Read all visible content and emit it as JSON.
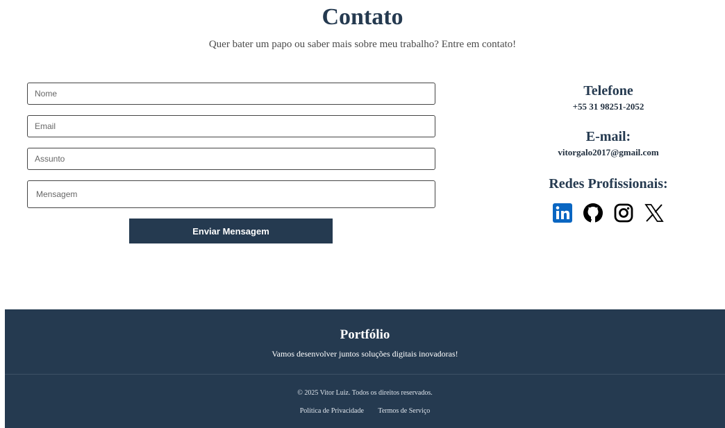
{
  "header": {
    "title": "Contato",
    "subtitle": "Quer bater um papo ou saber mais sobre meu trabalho? Entre em contato!"
  },
  "form": {
    "name_placeholder": "Nome",
    "email_placeholder": "Email",
    "subject_placeholder": "Assunto",
    "message_placeholder": "Mensagem",
    "submit_label": "Enviar Mensagem"
  },
  "contact": {
    "phone_heading": "Telefone",
    "phone_value": "+55 31 98251-2052",
    "email_heading": "E-mail:",
    "email_value": "vitorgalo2017@gmail.com",
    "social_heading": "Redes Profissionais:",
    "social_icons": [
      "linkedin-icon",
      "github-icon",
      "instagram-icon",
      "x-icon"
    ]
  },
  "footer": {
    "brand": "Portfólio",
    "tagline": "Vamos desenvolver juntos soluções digitais inovadoras!",
    "copyright": "© 2025 Vitor Luiz. Todos os direitos reservados.",
    "links": [
      "Política de Privacidade",
      "Termos de Serviço"
    ]
  },
  "colors": {
    "primary": "#253a50",
    "linkedin": "#0a66c2",
    "text": "#4a4a4a"
  }
}
